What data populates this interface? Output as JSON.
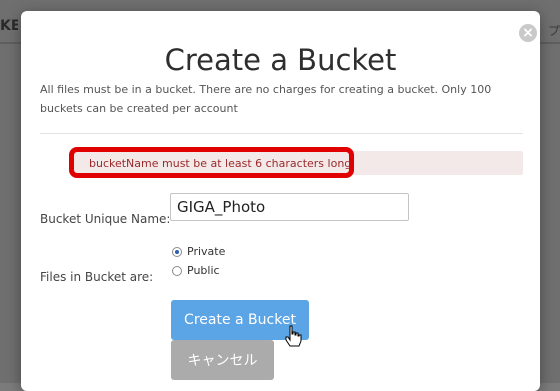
{
  "background": {
    "left_text": "KE",
    "right_text": "プ"
  },
  "modal": {
    "close_icon": "close-icon",
    "title": "Create a Bucket",
    "description": "All files must be in a bucket. There are no charges for creating a bucket. Only 100 buckets can be created per account",
    "error_message": "bucketName must be at least 6 characters long",
    "bucket_name_label": "Bucket Unique Name:",
    "bucket_name_value": "GIGA_Photo",
    "files_label": "Files in Bucket are:",
    "visibility_options": [
      {
        "label": "Private",
        "selected": true
      },
      {
        "label": "Public",
        "selected": false
      }
    ],
    "create_button": "Create a Bucket",
    "cancel_button": "キャンセル"
  },
  "colors": {
    "accent": "#5ba4e5",
    "error_highlight": "#e00000",
    "error_background": "#f4e9e9",
    "cancel_button": "#ababab"
  }
}
